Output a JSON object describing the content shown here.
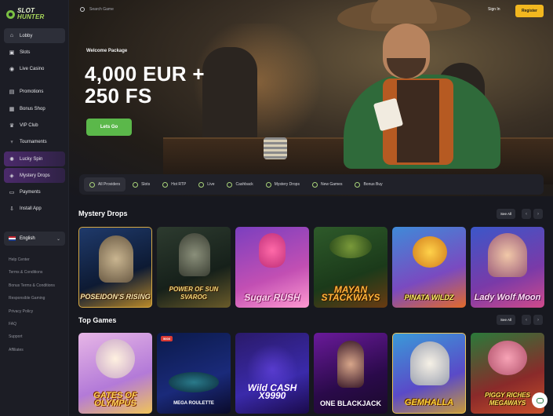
{
  "brand": {
    "line1": "SLOT",
    "line2": "HUNTER"
  },
  "header": {
    "search_placeholder": "Search Game",
    "signin_label": "Sign In",
    "register_label": "Register"
  },
  "sidebar": {
    "items": [
      {
        "label": "Lobby",
        "icon": "home-icon",
        "glyph": "⌂"
      },
      {
        "label": "Slots",
        "icon": "slot-icon",
        "glyph": "▣"
      },
      {
        "label": "Live Casino",
        "icon": "chip-icon",
        "glyph": "◉"
      },
      {
        "label": "Promotions",
        "icon": "gift-icon",
        "glyph": "▤"
      },
      {
        "label": "Bonus Shop",
        "icon": "shop-icon",
        "glyph": "▦"
      },
      {
        "label": "VIP Club",
        "icon": "crown-icon",
        "glyph": "♛"
      },
      {
        "label": "Tournaments",
        "icon": "trophy-icon",
        "glyph": "♆"
      },
      {
        "label": "Lucky Spin",
        "icon": "wheel-icon",
        "glyph": "✺"
      },
      {
        "label": "Mystery Drops",
        "icon": "drop-icon",
        "glyph": "◈"
      },
      {
        "label": "Payments",
        "icon": "card-icon",
        "glyph": "▭"
      },
      {
        "label": "Install App",
        "icon": "download-icon",
        "glyph": "⇩"
      }
    ],
    "language": "English",
    "footer_links": [
      "Help Center",
      "Terms & Conditions",
      "Bonus Terms & Conditions",
      "Responsible Gaming",
      "Privacy Policy",
      "FAQ",
      "Support",
      "Affiliates"
    ]
  },
  "hero": {
    "label": "Welcome Package",
    "title_line1": "4,000 EUR +",
    "title_line2": "250 FS",
    "cta": "Lets Go"
  },
  "providers": {
    "tabs": [
      {
        "label": "All Providers",
        "icon": "providers-icon"
      },
      {
        "label": "Slots",
        "icon": "slot-icon"
      },
      {
        "label": "Hot RTP",
        "icon": "fire-icon"
      },
      {
        "label": "Live",
        "icon": "live-icon"
      },
      {
        "label": "Cashback",
        "icon": "cashback-icon"
      },
      {
        "label": "Mystery Drops",
        "icon": "drop-icon"
      },
      {
        "label": "New Games",
        "icon": "new-icon"
      },
      {
        "label": "Bonus Buy",
        "icon": "bonus-icon"
      }
    ]
  },
  "sections": {
    "mystery": {
      "title": "Mystery Drops",
      "see_all": "See All",
      "games": [
        {
          "name": "POSEIDON'S RISING",
          "badge": ""
        },
        {
          "name": "POWER OF SUN SVAROG",
          "badge": ""
        },
        {
          "name": "Sugar RUSH",
          "badge": ""
        },
        {
          "name": "MAYAN STACKWAYS",
          "badge": ""
        },
        {
          "name": "PINATA WILDZ",
          "badge": ""
        },
        {
          "name": "Lady Wolf Moon",
          "badge": ""
        }
      ]
    },
    "top": {
      "title": "Top Games",
      "see_all": "See All",
      "games": [
        {
          "name": "GATES OF OLYMPUS",
          "badge": ""
        },
        {
          "name": "MEGA ROULETTE",
          "badge": "500X"
        },
        {
          "name": "Wild CASH X9990",
          "badge": ""
        },
        {
          "name": "ONE BLACKJACK",
          "badge": ""
        },
        {
          "name": "GEMHALLA",
          "badge": ""
        },
        {
          "name": "PIGGY RICHES MEGAWAYS",
          "badge": ""
        }
      ]
    }
  },
  "colors": {
    "accent_green": "#5bb84a",
    "register_yellow": "#f2b71f",
    "bg": "#17181f"
  }
}
